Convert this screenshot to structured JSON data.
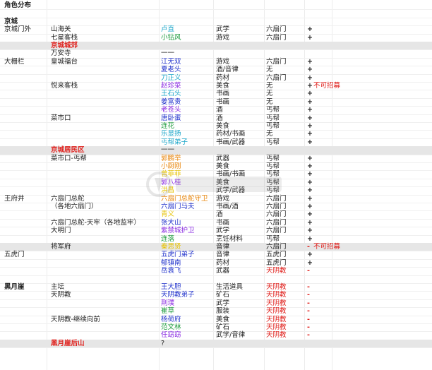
{
  "columns": [
    "area",
    "place",
    "npc",
    "skill",
    "faction",
    "mark",
    "note"
  ],
  "rows": [
    {
      "area": "角色分布",
      "bold": true
    },
    {},
    {
      "area": "京城",
      "bold": true
    },
    {
      "area": "京城门外",
      "place": "山海关",
      "npc": "卢直",
      "npc_color": "cyan",
      "skill": "武学",
      "faction": "六扇门",
      "mark": "+"
    },
    {
      "place": "七星客栈",
      "npc": "小钻风",
      "npc_color": "green",
      "skill": "游戏",
      "faction": "六扇门",
      "mark": "+"
    },
    {
      "sep": true,
      "place": "京城城郊",
      "place_color": "red"
    },
    {
      "place": "万安寺",
      "npc": "一一"
    },
    {
      "area": "大栅栏",
      "place": "皇城福台",
      "npc": "江无双",
      "npc_color": "blue",
      "skill": "游戏",
      "faction": "六扇门",
      "mark": "+"
    },
    {
      "npc": "夏老头",
      "npc_color": "blue",
      "skill": "酒/音律",
      "faction": "无",
      "mark": "+"
    },
    {
      "npc": "刀正义",
      "npc_color": "cyan",
      "skill": "药材",
      "faction": "六扇门",
      "mark": "+"
    },
    {
      "place": "悦来客栈",
      "npc": "赵珍菜",
      "npc_color": "purple",
      "skill": "美食",
      "faction": "无",
      "mark": "+",
      "note": "不可招募"
    },
    {
      "npc": "王石头",
      "npc_color": "cyan",
      "skill": "书画",
      "faction": "无",
      "mark": "+"
    },
    {
      "npc": "姜富贵",
      "npc_color": "blue",
      "skill": "书画",
      "faction": "无",
      "mark": "+"
    },
    {
      "npc": "老苍头",
      "npc_color": "purple",
      "skill": "酒",
      "faction": "丐帮",
      "mark": "+"
    },
    {
      "place": "菜市口",
      "npc": "唐卧蛋",
      "npc_color": "blue",
      "skill": "酒",
      "faction": "丐帮",
      "mark": "+"
    },
    {
      "npc": "连花",
      "npc_color": "green",
      "skill": "美食",
      "faction": "丐帮",
      "mark": "+"
    },
    {
      "npc": "乐显扬",
      "npc_color": "cyan",
      "skill": "药材/书画",
      "faction": "无",
      "mark": "+"
    },
    {
      "npc": "丐帮弟子",
      "npc_color": "cyan",
      "skill": "书画/武器",
      "faction": "丐帮",
      "mark": "+"
    },
    {
      "sep": true,
      "place": "京城居民区",
      "place_color": "red",
      "npc": "一一"
    },
    {
      "place": "菜市口-丐帮",
      "npc": "郭鹏举",
      "npc_color": "orange",
      "skill": "武器",
      "faction": "丐帮",
      "mark": "+"
    },
    {
      "npc": "小厨刚",
      "npc_color": "orange",
      "skill": "美食",
      "faction": "丐帮",
      "mark": "+"
    },
    {
      "npc": "曾菲菲",
      "npc_color": "yellow",
      "skill": "书画/书画",
      "faction": "丐帮",
      "mark": "+"
    },
    {
      "npc": "郭八桂",
      "npc_color": "purple",
      "skill": "美食",
      "faction": "丐帮",
      "mark": "+"
    },
    {
      "npc": "洪昌",
      "npc_color": "yellow",
      "skill": "武学/武器",
      "faction": "丐帮",
      "mark": "+"
    },
    {
      "area": "王府井",
      "place": "六扇门总舵",
      "npc": "六扇门总舵守卫",
      "npc_color": "orange",
      "skill": "游戏",
      "faction": "六扇门",
      "mark": "+"
    },
    {
      "place": "（各地六扇门）",
      "npc": "六扇门马夫",
      "npc_color": "blue",
      "skill": "书画/酒",
      "faction": "六扇门",
      "mark": "+"
    },
    {
      "npc": "青义",
      "npc_color": "yellow",
      "skill": "酒",
      "faction": "六扇门",
      "mark": "+"
    },
    {
      "place": "六扇门总舵-天牢（各地监牢）",
      "npc": "张大山",
      "npc_color": "blue",
      "skill": "书画",
      "faction": "六扇门",
      "mark": "+"
    },
    {
      "place": "大明门",
      "npc": "紫禁城护卫",
      "npc_color": "purple",
      "skill": "武学",
      "faction": "六扇门",
      "mark": "+"
    },
    {
      "npc": "连落",
      "npc_color": "green",
      "skill": "烹饪材料",
      "faction": "丐帮",
      "mark": "+"
    },
    {
      "place": "将军府",
      "npc": "秦思贤",
      "npc_color": "yellow",
      "skill": "音律",
      "faction": "六扇门",
      "mark": "-",
      "note": "不可招募",
      "sep": true
    },
    {
      "area": "五虎门",
      "npc": "五虎门弟子",
      "npc_color": "blue",
      "skill": "音律",
      "faction": "五虎门",
      "mark": "+"
    },
    {
      "npc": "郁镇南",
      "npc_color": "blue",
      "skill": "药材",
      "faction": "五虎门",
      "mark": "+"
    },
    {
      "npc": "岳袁飞",
      "npc_color": "blue",
      "skill": "武器",
      "faction": "天阴教",
      "faction_color": "red",
      "mark": "-"
    },
    {},
    {
      "area": "黑月崖",
      "area_bold": true,
      "place": "主坛",
      "npc": "王大胆",
      "npc_color": "blue",
      "skill": "生活道具",
      "faction": "天阴教",
      "faction_color": "red",
      "mark": "-"
    },
    {
      "place": "天阴教",
      "npc": "天阴教弟子",
      "npc_color": "blue",
      "skill": "矿石",
      "faction": "天阴教",
      "faction_color": "red",
      "mark": "-"
    },
    {
      "npc": "荆璞",
      "npc_color": "purple",
      "skill": "武学",
      "faction": "天阴教",
      "faction_color": "red",
      "mark": "-"
    },
    {
      "npc": "崔草",
      "npc_color": "green",
      "skill": "服装",
      "faction": "天阴教",
      "faction_color": "red",
      "mark": "-"
    },
    {
      "place": "天阴教-继续向前",
      "npc": "杨荷府",
      "npc_color": "blue",
      "skill": "美食",
      "faction": "天阴教",
      "faction_color": "red",
      "mark": "-"
    },
    {
      "npc": "范文林",
      "npc_color": "green",
      "skill": "矿石",
      "faction": "天阴教",
      "faction_color": "red",
      "mark": "-"
    },
    {
      "npc": "任窈窈",
      "npc_color": "purple",
      "skill": "武学/音律",
      "faction": "天阴教",
      "faction_color": "red",
      "mark": "-"
    },
    {
      "sep": true,
      "place": "黑月崖后山",
      "place_color": "red",
      "npc": "?"
    }
  ],
  "colors": {
    "red": "#e0201c",
    "green": "#1a9a3a",
    "blue": "#2233cc",
    "purple": "#8a2be2",
    "orange": "#e8850a",
    "yellow": "#e6c200",
    "cyan": "#1aa6c9"
  }
}
